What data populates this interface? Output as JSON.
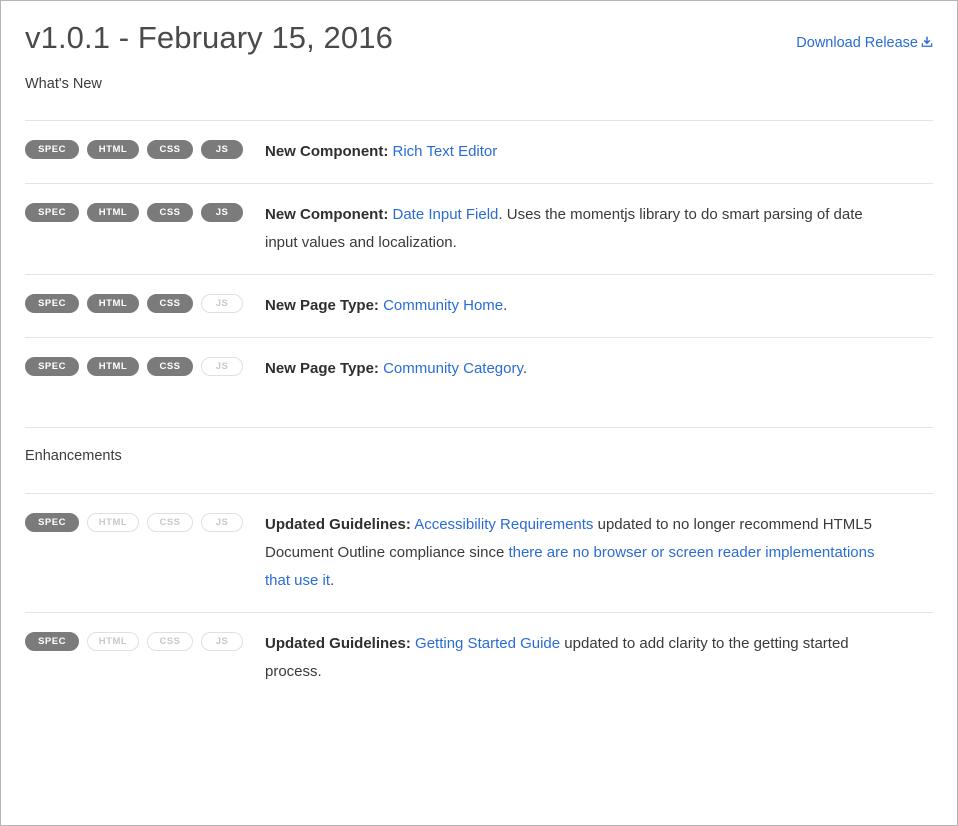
{
  "header": {
    "title": "v1.0.1 - February 15, 2016",
    "download_label": "Download Release",
    "download_icon": "download-tray-icon"
  },
  "badge_labels": {
    "spec": "SPEC",
    "html": "HTML",
    "css": "CSS",
    "js": "JS"
  },
  "colors": {
    "link": "#2b6cd4",
    "badge_active_bg": "#7b7b7b",
    "badge_active_text": "#ffffff",
    "badge_inactive_border": "#e0e0e0",
    "badge_inactive_text": "#c9c9c9",
    "divider": "#e4e4e4",
    "title_text": "#4a4a4a",
    "body_text": "#3a3a3a",
    "page_border": "#b5b5b5"
  },
  "sections": [
    {
      "heading": "What's New",
      "rows": [
        {
          "badges": {
            "spec": true,
            "html": true,
            "css": true,
            "js": true
          },
          "lead": "New Component:",
          "link1": "Rich Text Editor",
          "tail": ""
        },
        {
          "badges": {
            "spec": true,
            "html": true,
            "css": true,
            "js": true
          },
          "lead": "New Component:",
          "link1": "Date Input Field",
          "tail": ". Uses the momentjs library to do smart parsing of date input values and localization."
        },
        {
          "badges": {
            "spec": true,
            "html": true,
            "css": true,
            "js": false
          },
          "lead": "New Page Type:",
          "link1": "Community Home",
          "tail": "."
        },
        {
          "badges": {
            "spec": true,
            "html": true,
            "css": true,
            "js": false
          },
          "lead": "New Page Type:",
          "link1": "Community Category",
          "tail": "."
        }
      ]
    },
    {
      "heading": "Enhancements",
      "rows": [
        {
          "badges": {
            "spec": true,
            "html": false,
            "css": false,
            "js": false
          },
          "lead": "Updated Guidelines:",
          "link1": "Accessibility Requirements",
          "mid": " updated to no longer recommend HTML5 Document Outline compliance since ",
          "link2": "there are no browser or screen reader implementations that use it",
          "tail": "."
        },
        {
          "badges": {
            "spec": true,
            "html": false,
            "css": false,
            "js": false
          },
          "lead": "Updated Guidelines:",
          "link1": "Getting Started Guide",
          "tail": " updated to add clarity to the getting started process."
        }
      ]
    }
  ]
}
